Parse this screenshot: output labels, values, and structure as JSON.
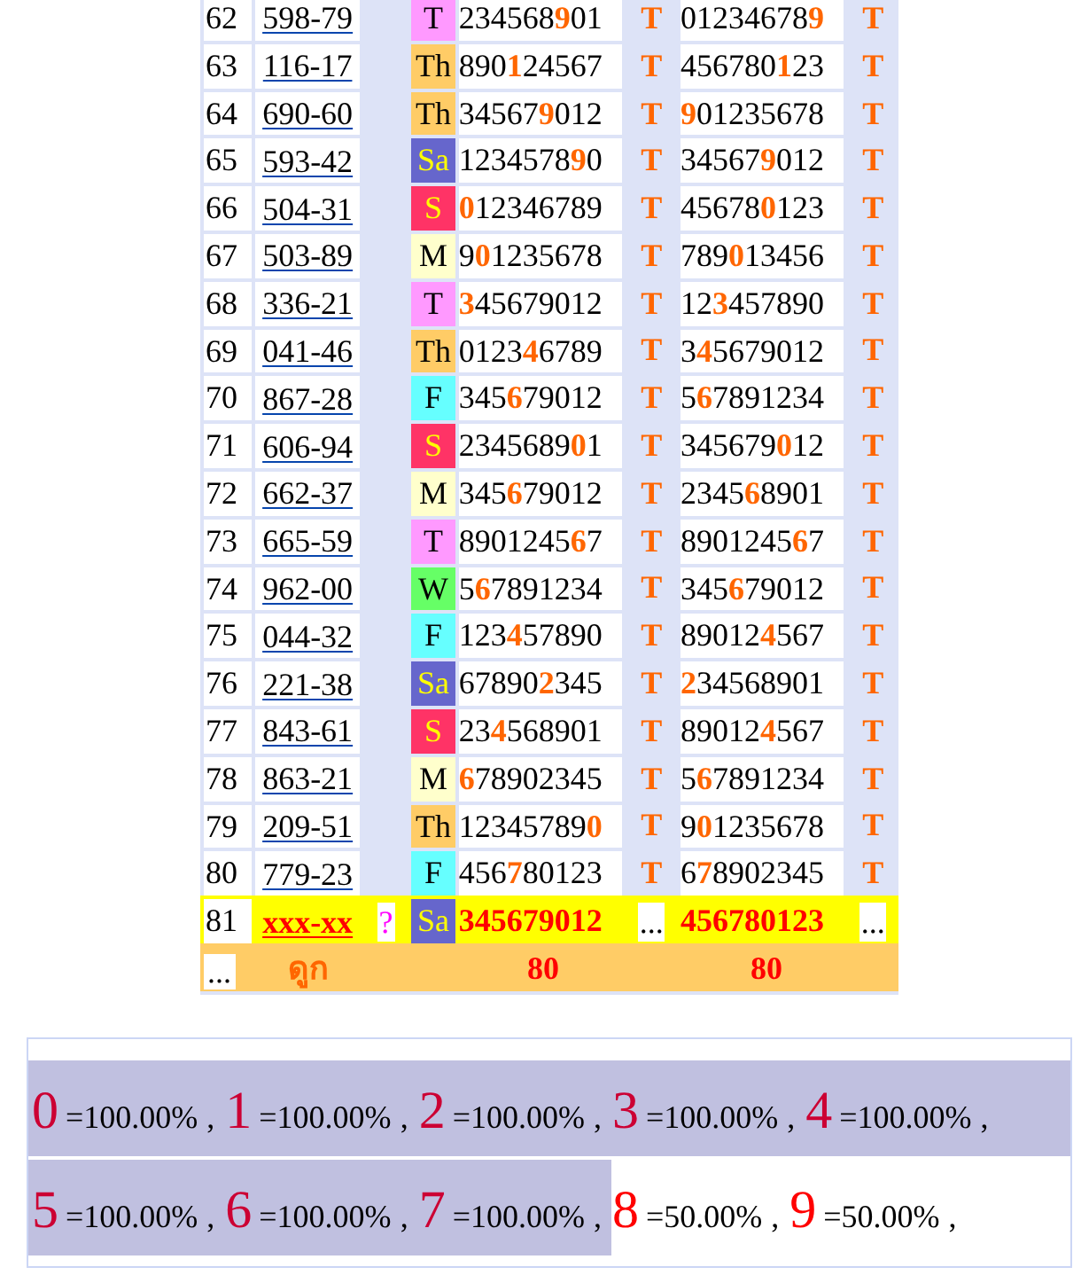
{
  "rows": [
    {
      "kind": "result",
      "no": "62",
      "code": "598-79",
      "day": {
        "label": "T",
        "color": "#ff99ff"
      },
      "set_1": "234568**9**01",
      "mark_1": "T",
      "set_2": "01234678**9**",
      "mark_2": "T"
    },
    {
      "kind": "result",
      "no": "63",
      "code": "116-17",
      "day": {
        "label": "Th",
        "color": "#ffcc66"
      },
      "set_1": "890**1**24567",
      "mark_1": "T",
      "set_2": "456780**1**23",
      "mark_2": "T"
    },
    {
      "kind": "result",
      "no": "64",
      "code": "690-60",
      "day": {
        "label": "Th",
        "color": "#ffcc66"
      },
      "set_1": "34567**9**012",
      "mark_1": "T",
      "set_2": "**9**01235678",
      "mark_2": "T"
    },
    {
      "kind": "result",
      "no": "65",
      "code": "593-42",
      "day": {
        "label": "Sa",
        "color": "#6666cc"
      },
      "set_1": "1234578**9**0",
      "mark_1": "T",
      "set_2": "34567**9**012",
      "mark_2": "T"
    },
    {
      "kind": "result",
      "no": "66",
      "code": "504-31",
      "day": {
        "label": "S",
        "color": "#ff3366"
      },
      "set_1": "**0**12346789",
      "mark_1": "T",
      "set_2": "45678**0**123",
      "mark_2": "T"
    },
    {
      "kind": "result",
      "no": "67",
      "code": "503-89",
      "day": {
        "label": "M",
        "color": "#ffffcc"
      },
      "set_1": "9**0**1235678",
      "mark_1": "T",
      "set_2": "789**0**13456",
      "mark_2": "T"
    },
    {
      "kind": "result",
      "no": "68",
      "code": "336-21",
      "day": {
        "label": "T",
        "color": "#ff99ff"
      },
      "set_1": "**3**45679012",
      "mark_1": "T",
      "set_2": "12**3**457890",
      "mark_2": "T"
    },
    {
      "kind": "result",
      "no": "69",
      "code": "041-46",
      "day": {
        "label": "Th",
        "color": "#ffcc66"
      },
      "set_1": "0123**4**6789",
      "mark_1": "T",
      "set_2": "3**4**5679012",
      "mark_2": "T"
    },
    {
      "kind": "result",
      "no": "70",
      "code": "867-28",
      "day": {
        "label": "F",
        "color": "#66ffff"
      },
      "set_1": "345**6**79012",
      "mark_1": "T",
      "set_2": "5**6**7891234",
      "mark_2": "T"
    },
    {
      "kind": "result",
      "no": "71",
      "code": "606-94",
      "day": {
        "label": "S",
        "color": "#ff3366"
      },
      "set_1": "2345689**0**1",
      "mark_1": "T",
      "set_2": "345679**0**12",
      "mark_2": "T"
    },
    {
      "kind": "result",
      "no": "72",
      "code": "662-37",
      "day": {
        "label": "M",
        "color": "#ffffcc"
      },
      "set_1": "345**6**79012",
      "mark_1": "T",
      "set_2": "2345**6**8901",
      "mark_2": "T"
    },
    {
      "kind": "result",
      "no": "73",
      "code": "665-59",
      "day": {
        "label": "T",
        "color": "#ff99ff"
      },
      "set_1": "8901245**6**7",
      "mark_1": "T",
      "set_2": "8901245**6**7",
      "mark_2": "T"
    },
    {
      "kind": "result",
      "no": "74",
      "code": "962-00",
      "day": {
        "label": "W",
        "color": "#66ff66"
      },
      "set_1": "5**6**7891234",
      "mark_1": "T",
      "set_2": "345**6**79012",
      "mark_2": "T"
    },
    {
      "kind": "result",
      "no": "75",
      "code": "044-32",
      "day": {
        "label": "F",
        "color": "#66ffff"
      },
      "set_1": "123**4**57890",
      "mark_1": "T",
      "set_2": "89012**4**567",
      "mark_2": "T"
    },
    {
      "kind": "result",
      "no": "76",
      "code": "221-38",
      "day": {
        "label": "Sa",
        "color": "#6666cc"
      },
      "set_1": "67890**2**345",
      "mark_1": "T",
      "set_2": "**2**34568901",
      "mark_2": "T"
    },
    {
      "kind": "result",
      "no": "77",
      "code": "843-61",
      "day": {
        "label": "S",
        "color": "#ff3366"
      },
      "set_1": "23**4**568901",
      "mark_1": "T",
      "set_2": "89012**4**567",
      "mark_2": "T"
    },
    {
      "kind": "result",
      "no": "78",
      "code": "863-21",
      "day": {
        "label": "M",
        "color": "#ffffcc"
      },
      "set_1": "**6**78902345",
      "mark_1": "T",
      "set_2": "5**6**7891234",
      "mark_2": "T"
    },
    {
      "kind": "result",
      "no": "79",
      "code": "209-51",
      "day": {
        "label": "Th",
        "color": "#ffcc66"
      },
      "set_1": "12345789**0**",
      "mark_1": "T",
      "set_2": "9**0**1235678",
      "mark_2": "T"
    },
    {
      "kind": "result",
      "no": "80",
      "code": "779-23",
      "day": {
        "label": "F",
        "color": "#66ffff"
      },
      "set_1": "456**7**80123",
      "mark_1": "T",
      "set_2": "6**7**8902345",
      "mark_2": "T"
    },
    {
      "kind": "pending",
      "no": "81",
      "code": "xxx-xx",
      "flag": "?",
      "day": {
        "label": "Sa",
        "color": "#6666cc"
      },
      "set_1": "345679012",
      "mark_1": "...",
      "set_2": "456780123",
      "mark_2": "..."
    }
  ],
  "totals": {
    "no": "...",
    "label": "ดูก",
    "count_1": "80",
    "count_2": "80"
  },
  "stats": [
    {
      "digit": "0",
      "value": "=100.00%",
      "sep": ",",
      "highlighted": true
    },
    {
      "digit": "1",
      "value": "=100.00%",
      "sep": ",",
      "highlighted": true
    },
    {
      "digit": "2",
      "value": "=100.00%",
      "sep": ",",
      "highlighted": true
    },
    {
      "digit": "3",
      "value": "=100.00%",
      "sep": ",",
      "highlighted": true
    },
    {
      "digit": "4",
      "value": "=100.00%",
      "sep": ",",
      "highlighted": true
    },
    {
      "digit": "5",
      "value": "=100.00%",
      "sep": ",",
      "highlighted": true
    },
    {
      "digit": "6",
      "value": "=100.00%",
      "sep": ",",
      "highlighted": true
    },
    {
      "digit": "7",
      "value": "=100.00%",
      "sep": ",",
      "highlighted": true
    },
    {
      "digit": "8",
      "value": "=50.00%",
      "sep": ",",
      "highlighted": false
    },
    {
      "digit": "9",
      "value": "=50.00%",
      "sep": ",",
      "highlighted": false
    }
  ]
}
